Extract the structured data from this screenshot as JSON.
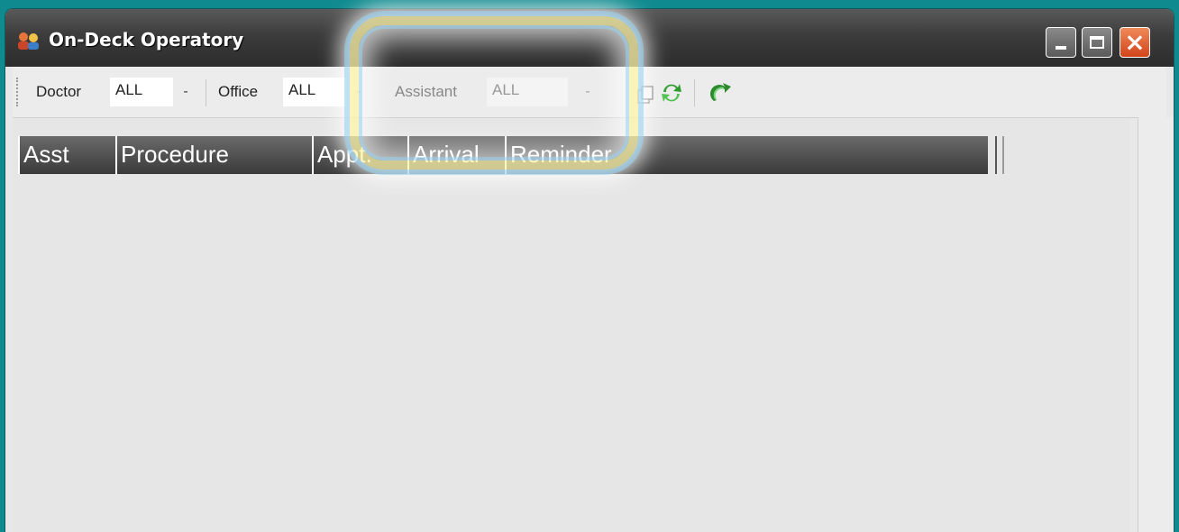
{
  "window": {
    "title": "On-Deck Operatory",
    "controls": {
      "minimize": "minimize",
      "maximize": "maximize",
      "close": "close"
    }
  },
  "toolbar": {
    "doctor_label": "Doctor",
    "doctor_value": "ALL",
    "office_label": "Office",
    "office_value": "ALL",
    "assistant_label": "Assistant",
    "assistant_value": "ALL",
    "dropdown_glyph": "-",
    "icons": [
      "copy-icon",
      "refresh-icon",
      "undo-icon"
    ]
  },
  "grid": {
    "columns": [
      "Asst",
      "Procedure",
      "Appt.",
      "Arrival",
      "Reminder"
    ],
    "rows": []
  },
  "colors": {
    "desktop": "#0f8a8e",
    "titlebar": "#3c3c3c",
    "header": "#4a4a4a",
    "close_button": "#d2441a",
    "highlight": "#fff5aa"
  }
}
